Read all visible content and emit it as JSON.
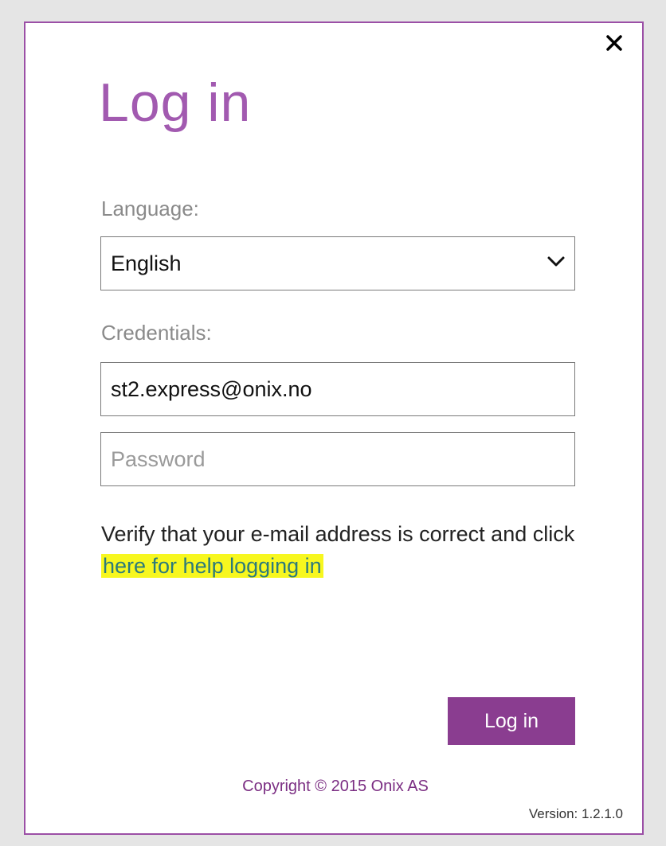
{
  "dialog": {
    "title": "Log in",
    "close_icon": "close-icon"
  },
  "language": {
    "label": "Language:",
    "selected": "English",
    "chevron_icon": "chevron-down-icon"
  },
  "credentials": {
    "label": "Credentials:",
    "email_value": "st2.express@onix.no",
    "password_placeholder": "Password"
  },
  "help": {
    "text_before": "Verify that your e-mail address is correct and click ",
    "link_text": "here for help logging in"
  },
  "login_button": {
    "label": "Log in"
  },
  "footer": {
    "copyright": "Copyright © 2015 Onix AS",
    "version": "Version: 1.2.1.0"
  },
  "colors": {
    "accent": "#8a3d90",
    "title": "#a25ab0",
    "border": "#9b4fa6",
    "link_highlight": "#f7f71f"
  }
}
